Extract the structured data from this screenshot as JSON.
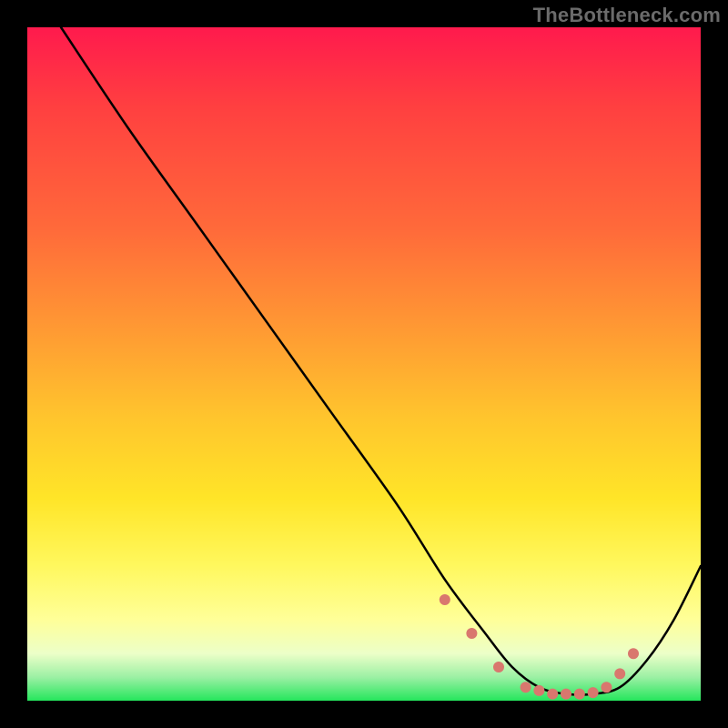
{
  "watermark": "TheBottleneck.com",
  "chart_data": {
    "type": "line",
    "title": "",
    "xlabel": "",
    "ylabel": "",
    "xlim": [
      0,
      100
    ],
    "ylim": [
      0,
      100
    ],
    "background_gradient": {
      "top": "#ff1a4d",
      "bottom": "#25e65c"
    },
    "series": [
      {
        "name": "bottleneck-curve",
        "color": "#000000",
        "x": [
          5,
          15,
          25,
          35,
          45,
          55,
          62,
          68,
          72,
          76,
          80,
          84,
          88,
          92,
          96,
          100
        ],
        "values": [
          100,
          85,
          71,
          57,
          43,
          29,
          18,
          10,
          5,
          2,
          1,
          1,
          2,
          6,
          12,
          20
        ]
      }
    ],
    "markers": {
      "name": "highlight-dots",
      "color": "#d9776e",
      "x": [
        62,
        66,
        70,
        74,
        76,
        78,
        80,
        82,
        84,
        86,
        88,
        90
      ],
      "values": [
        15,
        10,
        5,
        2,
        1.5,
        1,
        1,
        1,
        1.2,
        2,
        4,
        7
      ]
    }
  }
}
